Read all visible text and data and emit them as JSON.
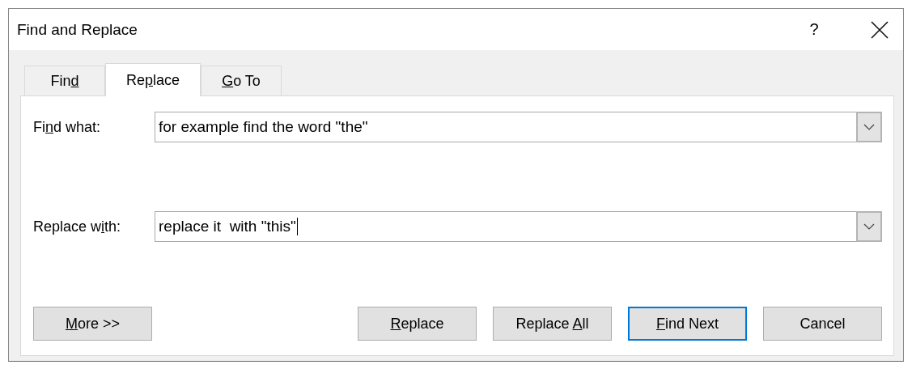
{
  "window": {
    "title": "Find and Replace",
    "help": "?"
  },
  "tabs": [
    {
      "label": [
        {
          "text": "Fin",
          "underlined": false
        },
        {
          "text": "d",
          "underlined": true
        }
      ],
      "selected": false
    },
    {
      "label": [
        {
          "text": "Re",
          "underlined": false
        },
        {
          "text": "p",
          "underlined": true
        },
        {
          "text": "lace",
          "underlined": false
        }
      ],
      "selected": true
    },
    {
      "label": [
        {
          "text": "G",
          "underlined": true
        },
        {
          "text": "o To",
          "underlined": false
        }
      ],
      "selected": false
    }
  ],
  "fields": [
    {
      "label": [
        {
          "text": "Fi",
          "underlined": false
        },
        {
          "text": "n",
          "underlined": true
        },
        {
          "text": "d what:",
          "underlined": false
        }
      ],
      "value": "for example find the word \"the\"",
      "focused": false
    },
    {
      "label": [
        {
          "text": "Replace w",
          "underlined": false
        },
        {
          "text": "i",
          "underlined": true
        },
        {
          "text": "th:",
          "underlined": false
        }
      ],
      "value": "replace it  with \"this\"",
      "focused": true
    }
  ],
  "more_button": {
    "label": [
      {
        "text": "M",
        "underlined": true
      },
      {
        "text": "ore >>",
        "underlined": false
      }
    ],
    "default": false
  },
  "buttons": [
    {
      "label": [
        {
          "text": "R",
          "underlined": true
        },
        {
          "text": "eplace",
          "underlined": false
        }
      ],
      "default": false
    },
    {
      "label": [
        {
          "text": "Replace ",
          "underlined": false
        },
        {
          "text": "A",
          "underlined": true
        },
        {
          "text": "ll",
          "underlined": false
        }
      ],
      "default": false
    },
    {
      "label": [
        {
          "text": "F",
          "underlined": true
        },
        {
          "text": "ind Next",
          "underlined": false
        }
      ],
      "default": true
    },
    {
      "label": [
        {
          "text": "Cancel",
          "underlined": false
        }
      ],
      "default": false
    }
  ]
}
